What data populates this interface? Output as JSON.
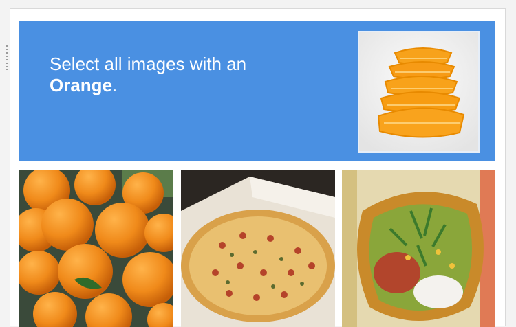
{
  "challenge": {
    "instruction": "Select all images with an",
    "target_word": "Orange",
    "punctuation": ".",
    "accent_color": "#4a90e2"
  },
  "tiles": [
    {
      "subject": "oranges"
    },
    {
      "subject": "pizza"
    },
    {
      "subject": "taco salad"
    }
  ]
}
